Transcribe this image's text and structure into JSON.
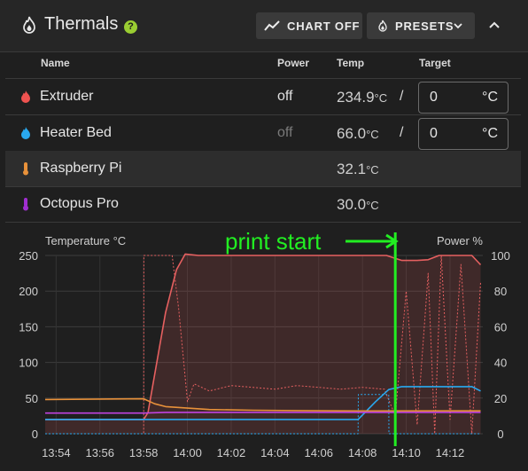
{
  "header": {
    "title": "Thermals",
    "help_icon": "?",
    "chart_button": "CHART OFF",
    "presets_button": "PRESETS"
  },
  "columns": {
    "name": "Name",
    "power": "Power",
    "temp": "Temp",
    "target": "Target"
  },
  "rows": [
    {
      "name": "Extruder",
      "icon_color": "#ef5350",
      "power": "off",
      "power_color": "#e0e0e0",
      "temp": "234.9",
      "unit": "°C",
      "slash": "/",
      "target_value": "0",
      "target_unit": "°C"
    },
    {
      "name": "Heater Bed",
      "icon_color": "#29a9f0",
      "power": "off",
      "power_color": "#7a7a7a",
      "temp": "66.0",
      "unit": "°C",
      "slash": "/",
      "target_value": "0",
      "target_unit": "°C"
    },
    {
      "name": "Raspberry Pi",
      "icon_color": "#e8913a",
      "temp": "32.1",
      "unit": "°C"
    },
    {
      "name": "Octopus Pro",
      "icon_color": "#a02ed0",
      "temp": "30.0",
      "unit": "°C"
    }
  ],
  "annotation": {
    "text": "print start",
    "color": "#22ee22",
    "at_x": "14:09.5"
  },
  "chart_data": {
    "type": "line",
    "ylabel": "Temperature °C",
    "y2label": "Power %",
    "ylim": [
      0,
      250
    ],
    "y2lim": [
      0,
      100
    ],
    "yticks": [
      "250",
      "200",
      "150",
      "100",
      "50",
      "0"
    ],
    "y2ticks": [
      "100",
      "80",
      "60",
      "40",
      "20",
      "0"
    ],
    "xlim": [
      "13:53.5",
      "14:13.5"
    ],
    "xticks": [
      "13:54",
      "13:56",
      "13:58",
      "14:00",
      "14:02",
      "14:04",
      "14:06",
      "14:08",
      "14:10",
      "14:12"
    ],
    "grid": true,
    "series": [
      {
        "color": "#e66060",
        "style": "solid",
        "axis": "temp",
        "points": [
          [
            "13:53.5",
            20
          ],
          [
            "13:58.0",
            20
          ],
          [
            "13:58.2",
            30
          ],
          [
            "13:59.0",
            170
          ],
          [
            "13:59.5",
            230
          ],
          [
            "13:59.9",
            252
          ],
          [
            "14:00.5",
            250
          ],
          [
            "14:09.1",
            250
          ],
          [
            "14:09.5",
            246
          ],
          [
            "14:09.8",
            243
          ],
          [
            "14:10.5",
            243
          ],
          [
            "14:11.0",
            244
          ],
          [
            "14:11.5",
            250
          ],
          [
            "14:12.5",
            250
          ],
          [
            "14:13.0",
            250
          ],
          [
            "14:13.4",
            237
          ]
        ]
      },
      {
        "color": "#e66060",
        "style": "dotted",
        "axis": "power",
        "points": [
          [
            "13:53.5",
            0
          ],
          [
            "13:58.0",
            0
          ],
          [
            "13:58.01",
            100
          ],
          [
            "13:59.0",
            100
          ],
          [
            "13:59.3",
            100
          ],
          [
            "13:59.6",
            70
          ],
          [
            "14:00.0",
            18
          ],
          [
            "14:00.3",
            28
          ],
          [
            "14:01.0",
            24
          ],
          [
            "14:02.0",
            27
          ],
          [
            "14:03.0",
            26
          ],
          [
            "14:04.0",
            25
          ],
          [
            "14:05.0",
            27
          ],
          [
            "14:06.0",
            26
          ],
          [
            "14:07.0",
            25
          ],
          [
            "14:08.0",
            26
          ],
          [
            "14:09.0",
            25
          ],
          [
            "14:09.5",
            10
          ],
          [
            "14:10.0",
            80
          ],
          [
            "14:10.5",
            5
          ],
          [
            "14:11.0",
            90
          ],
          [
            "14:11.3",
            0
          ],
          [
            "14:11.6",
            100
          ],
          [
            "14:12.0",
            8
          ],
          [
            "14:12.5",
            95
          ],
          [
            "14:13.0",
            0
          ],
          [
            "14:13.4",
            85
          ]
        ]
      },
      {
        "color": "#29a9f0",
        "style": "solid",
        "axis": "temp",
        "points": [
          [
            "13:53.5",
            20
          ],
          [
            "14:07.8",
            20
          ],
          [
            "14:08.6",
            45
          ],
          [
            "14:09.2",
            62
          ],
          [
            "14:09.8",
            66
          ],
          [
            "14:13.0",
            66
          ],
          [
            "14:13.4",
            60
          ]
        ]
      },
      {
        "color": "#29a9f0",
        "style": "dotted",
        "axis": "power",
        "points": [
          [
            "13:53.5",
            0
          ],
          [
            "14:07.8",
            0
          ],
          [
            "14:07.81",
            22
          ],
          [
            "14:09.2",
            22
          ],
          [
            "14:09.21",
            0
          ],
          [
            "14:13.4",
            0
          ]
        ]
      },
      {
        "color": "#e8913a",
        "style": "solid",
        "axis": "temp",
        "points": [
          [
            "13:53.5",
            48
          ],
          [
            "13:58.0",
            49
          ],
          [
            "13:58.5",
            42
          ],
          [
            "13:59.0",
            38
          ],
          [
            "14:00.0",
            36
          ],
          [
            "14:01.0",
            34
          ],
          [
            "14:03.0",
            33
          ],
          [
            "14:05.0",
            32.5
          ],
          [
            "14:08.0",
            32
          ],
          [
            "14:13.4",
            32.1
          ]
        ]
      },
      {
        "color": "#c043e0",
        "style": "solid",
        "axis": "temp",
        "points": [
          [
            "13:53.5",
            29
          ],
          [
            "13:58.0",
            29
          ],
          [
            "13:59.0",
            30
          ],
          [
            "14:13.4",
            30
          ]
        ]
      }
    ]
  }
}
